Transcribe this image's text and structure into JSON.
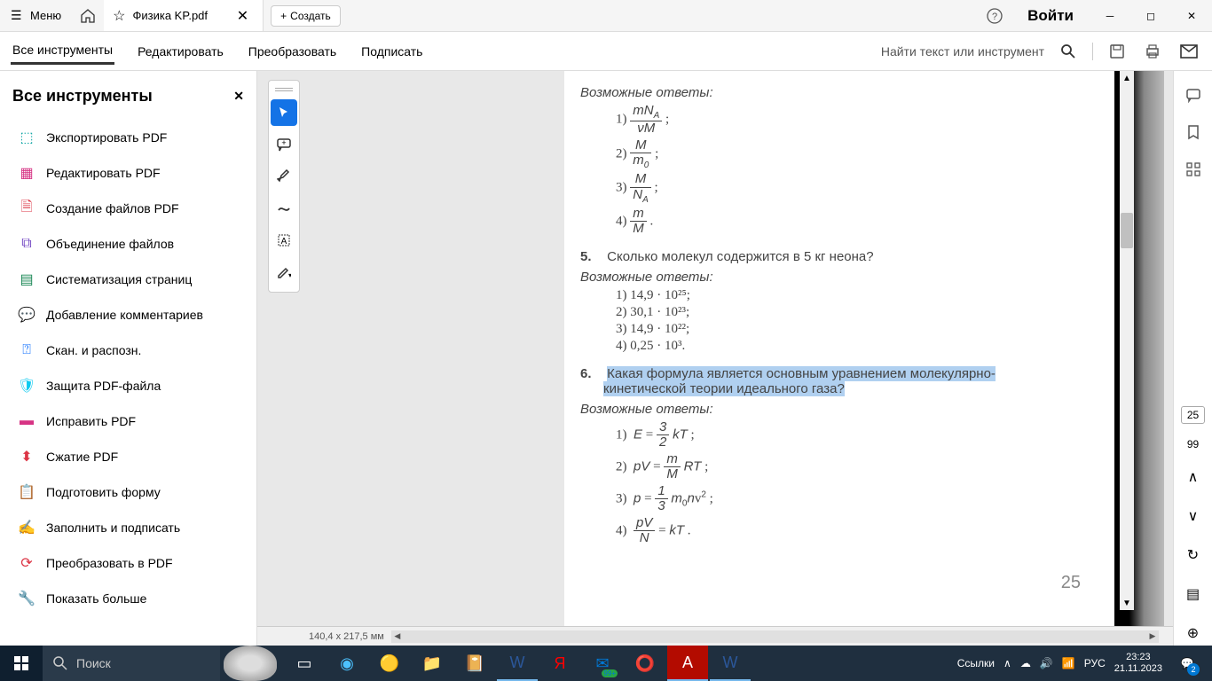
{
  "titlebar": {
    "menu_label": "Меню",
    "tab_title": "Физика KP.pdf",
    "create_label": "Создать",
    "login_label": "Войти"
  },
  "menubar": {
    "items": [
      "Все инструменты",
      "Редактировать",
      "Преобразовать",
      "Подписать"
    ],
    "search_placeholder": "Найти текст или инструмент"
  },
  "sidebar": {
    "title": "Все инструменты",
    "items": [
      {
        "label": "Экспортировать PDF",
        "color": "#00a0a0"
      },
      {
        "label": "Редактировать PDF",
        "color": "#d63384"
      },
      {
        "label": "Создание файлов PDF",
        "color": "#dc3545"
      },
      {
        "label": "Объединение файлов",
        "color": "#6f42c1"
      },
      {
        "label": "Систематизация страниц",
        "color": "#198754"
      },
      {
        "label": "Добавление комментариев",
        "color": "#ffc107"
      },
      {
        "label": "Скан. и распозн.",
        "color": "#0d6efd"
      },
      {
        "label": "Защита PDF-файла",
        "color": "#0dcaf0"
      },
      {
        "label": "Исправить PDF",
        "color": "#d63384"
      },
      {
        "label": "Сжатие PDF",
        "color": "#dc3545"
      },
      {
        "label": "Подготовить форму",
        "color": "#6f42c1"
      },
      {
        "label": "Заполнить и подписать",
        "color": "#6f42c1"
      },
      {
        "label": "Преобразовать в PDF",
        "color": "#dc3545"
      },
      {
        "label": "Показать больше",
        "color": "#555"
      }
    ]
  },
  "document": {
    "answers_label": "Возможные ответы:",
    "q4_options": [
      {
        "n": "1)",
        "num": "mN_A",
        "den": "νM"
      },
      {
        "n": "2)",
        "num": "M",
        "den": "m₀"
      },
      {
        "n": "3)",
        "num": "M",
        "den": "N_A"
      },
      {
        "n": "4)",
        "num": "m",
        "den": "M"
      }
    ],
    "q5_num": "5.",
    "q5_text": "Сколько молекул содержится в 5 кг неона?",
    "q5_options": [
      "1) 14,9 · 10²⁵;",
      "2) 30,1 · 10²³;",
      "3) 14,9 · 10²²;",
      "4) 0,25 · 10³."
    ],
    "q6_num": "6.",
    "q6_line1": "Какая формула является основным уравнением молекулярно-",
    "q6_line2": "кинетической теории идеального газа?",
    "q6_options": [
      "1)  E = ³⁄₂ kT ;",
      "2)  pV = (m/M) RT ;",
      "3)  p = ¹⁄₃ m₀nv² ;",
      "4)  pV/N = kT ."
    ],
    "page_number": "25"
  },
  "rpanel": {
    "current_page": "25",
    "total_pages": "99"
  },
  "statusbar": {
    "dimensions": "140,4 x 217,5 мм"
  },
  "taskbar": {
    "search_placeholder": "Поиск",
    "links_label": "Ссылки",
    "lang": "РУС",
    "time": "23:23",
    "date": "21.11.2023",
    "notif_count": "2",
    "mail_badge": "99+"
  }
}
